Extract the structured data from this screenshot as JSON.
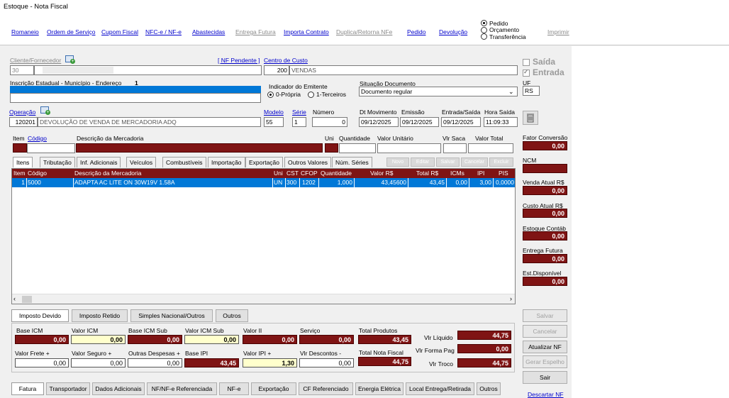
{
  "window": {
    "title": "Estoque - Nota Fiscal"
  },
  "toolbar": {
    "links": [
      {
        "label": "Romaneio",
        "enabled": true
      },
      {
        "label": "Ordem de Serviço",
        "enabled": true
      },
      {
        "label": "Cupom Fiscal",
        "enabled": true
      },
      {
        "label": "NFC-e / NF-e",
        "enabled": true
      },
      {
        "label": "Abastecidas",
        "enabled": true
      },
      {
        "label": "Entrega Futura",
        "enabled": false
      },
      {
        "label": "Importa Contrato",
        "enabled": true
      },
      {
        "label": "Duplica/Retorna NFe",
        "enabled": false
      },
      {
        "label": "Pedido",
        "enabled": true
      },
      {
        "label": "Devolução",
        "enabled": true
      }
    ],
    "print_label": "Imprimir",
    "doc_type_options": [
      {
        "label": "Pedido",
        "selected": true
      },
      {
        "label": "Orçamento",
        "selected": false
      },
      {
        "label": "Transferência",
        "selected": false
      }
    ]
  },
  "header": {
    "cliente_label": "Cliente/Fornecedor",
    "cliente_code": "30",
    "cliente_name": "",
    "nf_pendente_label": "[ NF Pendente ]",
    "centro_custo_label": "Centro de Custo",
    "centro_custo_code": "200",
    "centro_custo_name": "VENDAS",
    "saida_label": "Saída",
    "saida_checked": false,
    "entrada_label": "Entrada",
    "entrada_checked": true,
    "ie_label": "Inscrição Estadual - Município - Endereço",
    "ie_number": "1",
    "indicador_label": "Indicador do Emitente",
    "indicador_options": [
      {
        "label": "0-Própria",
        "selected": true
      },
      {
        "label": "1-Terceiros",
        "selected": false
      }
    ],
    "situacao_label": "Situação Documento",
    "situacao_value": "Documento regular",
    "uf_label": "UF",
    "uf_value": "RS",
    "operacao_label": "Operação",
    "operacao_code": "120201",
    "operacao_desc": "DEVOLUÇÃO DE VENDA DE MERCADORIA ADQ",
    "modelo_label": "Modelo",
    "modelo_value": "55",
    "serie_label": "Série",
    "serie_value": "1",
    "numero_label": "Número",
    "numero_value": "0",
    "dt_movimento_label": "Dt Movimento",
    "dt_movimento_value": "09/12/2025",
    "emissao_label": "Emissão",
    "emissao_value": "09/12/2025",
    "entrada_saida_label": "Entrada/Saída",
    "entrada_saida_value": "09/12/2025",
    "hora_saida_label": "Hora Saída",
    "hora_saida_value": "11:09:33"
  },
  "entry_row": {
    "item_label": "Item",
    "codigo_label": "Código",
    "descricao_label": "Descrição da Mercadoria",
    "uni_label": "Uni",
    "quantidade_label": "Quantidade",
    "valor_unitario_label": "Valor Unitário",
    "vlr_saca_label": "Vlr Saca",
    "valor_total_label": "Valor Total"
  },
  "tabs": [
    "Itens",
    "Tributação",
    "Inf. Adicionais",
    "Veículos",
    "Combustíveis",
    "Importação",
    "Exportação",
    "Outros Valores",
    "Núm. Séries"
  ],
  "grid_buttons": [
    "Novo",
    "Editar",
    "Salvar",
    "Cancelar",
    "Excluir"
  ],
  "grid": {
    "columns": [
      "Item",
      "Código",
      "Descrição da Mercadoria",
      "Uni",
      "CST",
      "CFOP",
      "Quantidade",
      "Valor R$",
      "Total R$",
      "ICMs",
      "IPI",
      "PIS"
    ],
    "rows": [
      [
        "1",
        "5000",
        "ADAPTA AC LITE ON 30W19V 1.58A",
        "UN",
        "300",
        "1202",
        "1,000",
        "43,45600",
        "43,45",
        "0,00",
        "3,00",
        "0,0000"
      ]
    ]
  },
  "right_panel": {
    "fator_conversao_label": "Fator Conversão",
    "fator_conversao_value": "0,00",
    "ncm_label": "NCM",
    "ncm_value": "",
    "venda_atual_label": "Venda Atual R$",
    "venda_atual_value": "0,00",
    "custo_atual_label": "Custo Atual R$",
    "custo_atual_value": "0,00",
    "estoque_contab_label": "Estoque Contáb",
    "estoque_contab_value": "0,00",
    "entrega_futura_label": "Entrega Futura",
    "entrega_futura_value": "0,00",
    "est_disponivel_label": "Est.Disponível",
    "est_disponivel_value": "0,00"
  },
  "tax_tabs": [
    "Imposto Devido",
    "Imposto Retido",
    "Simples Nacional/Outros",
    "Outros"
  ],
  "taxes": {
    "base_icm_label": "Base ICM",
    "base_icm": "0,00",
    "valor_icm_label": "Valor ICM",
    "valor_icm": "0,00",
    "base_icm_sub_label": "Base ICM Sub",
    "base_icm_sub": "0,00",
    "valor_icm_sub_label": "Valor ICM Sub",
    "valor_icm_sub": "0,00",
    "valor_ii_label": "Valor II",
    "valor_ii": "0,00",
    "servico_label": "Serviço",
    "servico": "0,00",
    "total_produtos_label": "Total Produtos",
    "total_produtos": "43,45",
    "vlr_liquido_label": "Vlr Líquido",
    "vlr_liquido": "44,75",
    "valor_frete_label": "Valor Frete +",
    "valor_frete": "0,00",
    "valor_seguro_label": "Valor Seguro +",
    "valor_seguro": "0,00",
    "outras_despesas_label": "Outras Despesas +",
    "outras_despesas": "0,00",
    "base_ipi_label": "Base IPI",
    "base_ipi": "43,45",
    "valor_ipi_label": "Valor IPI +",
    "valor_ipi": "1,30",
    "vlr_descontos_label": "Vlr Descontos -",
    "vlr_descontos": "0,00",
    "total_nota_label": "Total Nota Fiscal",
    "total_nota": "44,75",
    "vlr_forma_pag_label": "Vlr Forma Pag",
    "vlr_forma_pag": "0,00",
    "vlr_troco_label": "Vlr Troco",
    "vlr_troco": "44,75"
  },
  "action_buttons": [
    {
      "label": "Salvar",
      "enabled": false
    },
    {
      "label": "Cancelar",
      "enabled": false
    },
    {
      "label": "Atualizar NF",
      "enabled": true
    },
    {
      "label": "Gerar Espelho",
      "enabled": false
    },
    {
      "label": "Sair",
      "enabled": true
    }
  ],
  "descartar_label": "Descartar NF",
  "bottom_tabs": [
    "Fatura",
    "Transportador",
    "Dados Adicionais",
    "NF/NF-e Referenciada",
    "NF-e",
    "Exportação",
    "CF Referenciado",
    "Energia Elétrica",
    "Local Entrega/Retirada",
    "Outros"
  ]
}
